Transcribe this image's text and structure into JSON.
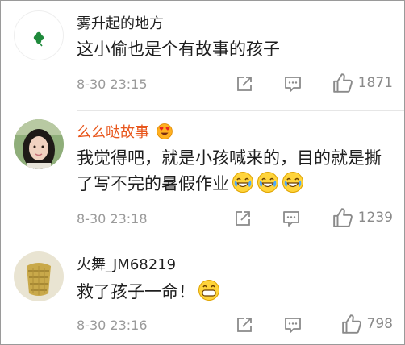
{
  "comments": [
    {
      "username": "雾升起的地方",
      "username_color": "#3d3d3d",
      "text": "这小偷也是个有故事的孩子",
      "time": "8-30 23:15",
      "likes": "1871",
      "avatar": "clover-avatar"
    },
    {
      "username": "么么哒故事",
      "username_color": "#e8571d",
      "badge_icon": "heart-eyes-emoji",
      "text": "我觉得吧，就是小孩喊来的，目的就是撕了写不完的暑假作业",
      "trailing_emoji": [
        "laugh-cry-emoji",
        "laugh-cry-emoji",
        "laugh-cry-emoji"
      ],
      "time": "8-30 23:18",
      "likes": "1239",
      "avatar": "girl-photo-avatar"
    },
    {
      "username": "火舞_JM68219",
      "username_color": "#3d3d3d",
      "text": "救了孩子一命！",
      "trailing_emoji": [
        "grin-emoji"
      ],
      "time": "8-30 23:16",
      "likes": "798",
      "avatar": "cup-photo-avatar"
    }
  ],
  "icons": [
    "share-icon",
    "comment-icon",
    "thumbs-up-icon"
  ],
  "colors": {
    "meta_gray": "#9a9a9a",
    "divider": "#e6e6e6",
    "accent_orange": "#e8571d"
  }
}
